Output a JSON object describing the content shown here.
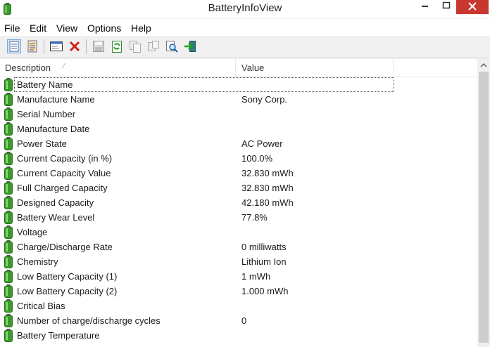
{
  "window": {
    "title": "BatteryInfoView"
  },
  "menu": {
    "items": [
      "File",
      "Edit",
      "View",
      "Options",
      "Help"
    ]
  },
  "toolbar": {
    "icons": [
      "html-report-icon",
      "report-icon",
      "properties-icon",
      "delete-icon",
      "save-icon",
      "refresh-icon",
      "copy-icon",
      "copy-all-icon",
      "find-icon",
      "exit-icon"
    ]
  },
  "columns": {
    "description": "Description",
    "value": "Value"
  },
  "rows": [
    {
      "desc": "Battery Name",
      "value": ""
    },
    {
      "desc": "Manufacture Name",
      "value": "Sony Corp."
    },
    {
      "desc": "Serial Number",
      "value": ""
    },
    {
      "desc": "Manufacture Date",
      "value": ""
    },
    {
      "desc": "Power State",
      "value": "AC Power"
    },
    {
      "desc": "Current Capacity (in %)",
      "value": "100.0%"
    },
    {
      "desc": "Current Capacity Value",
      "value": "32.830 mWh"
    },
    {
      "desc": "Full Charged Capacity",
      "value": "32.830 mWh"
    },
    {
      "desc": "Designed Capacity",
      "value": "42.180 mWh"
    },
    {
      "desc": "Battery Wear Level",
      "value": "77.8%"
    },
    {
      "desc": "Voltage",
      "value": ""
    },
    {
      "desc": "Charge/Discharge Rate",
      "value": "0 milliwatts"
    },
    {
      "desc": "Chemistry",
      "value": "Lithium Ion"
    },
    {
      "desc": "Low Battery Capacity (1)",
      "value": "1 mWh"
    },
    {
      "desc": "Low Battery Capacity (2)",
      "value": "1.000 mWh"
    },
    {
      "desc": "Critical Bias",
      "value": ""
    },
    {
      "desc": "Number of charge/discharge cycles",
      "value": "0"
    },
    {
      "desc": "Battery Temperature",
      "value": ""
    }
  ],
  "colors": {
    "close_button": "#c7372f",
    "battery_green": "#3a9b2a"
  }
}
